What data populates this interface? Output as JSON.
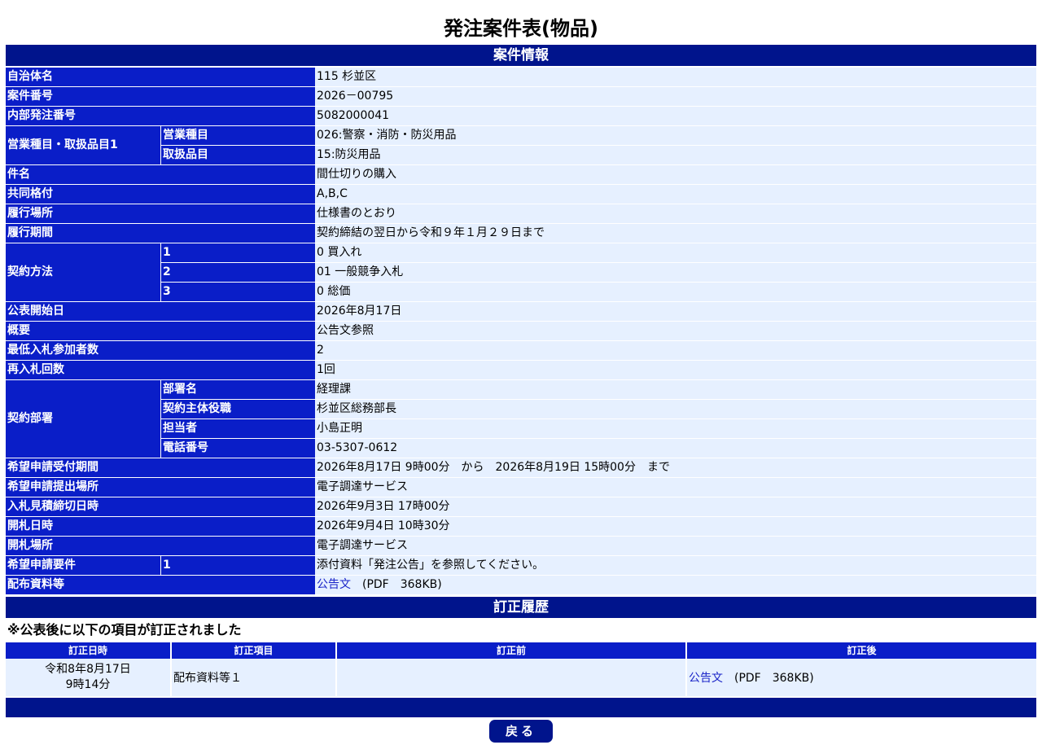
{
  "page_title": "発注案件表(物品)",
  "section_info": "案件情報",
  "rows": {
    "municipality": {
      "label": "自治体名",
      "value": "115 杉並区"
    },
    "case_no": {
      "label": "案件番号",
      "value": "2026－00795"
    },
    "internal_no": {
      "label": "内部発注番号",
      "value": "5082000041"
    },
    "business": {
      "label": "営業種目・取扱品目1",
      "sub1": "営業種目",
      "val1": "026:警察・消防・防災用品",
      "sub2": "取扱品目",
      "val2": "15:防災用品"
    },
    "subject": {
      "label": "件名",
      "value": "間仕切りの購入"
    },
    "rank": {
      "label": "共同格付",
      "value": "A,B,C"
    },
    "place": {
      "label": "履行場所",
      "value": "仕様書のとおり"
    },
    "period": {
      "label": "履行期間",
      "value": "契約締結の翌日から令和９年１月２９日まで"
    },
    "method": {
      "label": "契約方法",
      "sub1": "1",
      "val1": "0 買入れ",
      "sub2": "2",
      "val2": "01 一般競争入札",
      "sub3": "3",
      "val3": "0 総価"
    },
    "publish_date": {
      "label": "公表開始日",
      "value": "2026年8月17日"
    },
    "summary": {
      "label": "概要",
      "value": "公告文参照"
    },
    "min_bidders": {
      "label": "最低入札参加者数",
      "value": "2"
    },
    "rebid": {
      "label": "再入札回数",
      "value": "1回"
    },
    "department": {
      "label": "契約部署",
      "sub1": "部署名",
      "val1": "経理課",
      "sub2": "契約主体役職",
      "val2": "杉並区総務部長",
      "sub3": "担当者",
      "val3": "小島正明",
      "sub4": "電話番号",
      "val4": "03-5307-0612"
    },
    "application_period": {
      "label": "希望申請受付期間",
      "value": "2026年8月17日 9時00分　から　2026年8月19日 15時00分　まで"
    },
    "application_place": {
      "label": "希望申請提出場所",
      "value": "電子調達サービス"
    },
    "bid_deadline": {
      "label": "入札見積締切日時",
      "value": "2026年9月3日 17時00分"
    },
    "opening_date": {
      "label": "開札日時",
      "value": "2026年9月4日 10時30分"
    },
    "opening_place": {
      "label": "開札場所",
      "value": "電子調達サービス"
    },
    "requirement": {
      "label": "希望申請要件",
      "sub1": "1",
      "value": "添付資料「発注公告」を参照してください。"
    },
    "documents": {
      "label": "配布資料等",
      "link": "公告文",
      "info": "　(PDF　368KB)"
    }
  },
  "section_history": "訂正履歴",
  "history_note": "※公表後に以下の項目が訂正されました",
  "history": {
    "headers": {
      "date": "訂正日時",
      "item": "訂正項目",
      "before": "訂正前",
      "after": "訂正後"
    },
    "row": {
      "date_line1": "令和8年8月17日",
      "date_line2": "9時14分",
      "item": "配布資料等１",
      "before": "",
      "after_link": "公告文",
      "after_info": "　(PDF　368KB)"
    }
  },
  "back_button": "戻る",
  "colors": {
    "header_band": "#00148c",
    "label_cell": "#0a1ec8",
    "value_cell": "#e6f0ff",
    "link": "#1a24c8"
  }
}
